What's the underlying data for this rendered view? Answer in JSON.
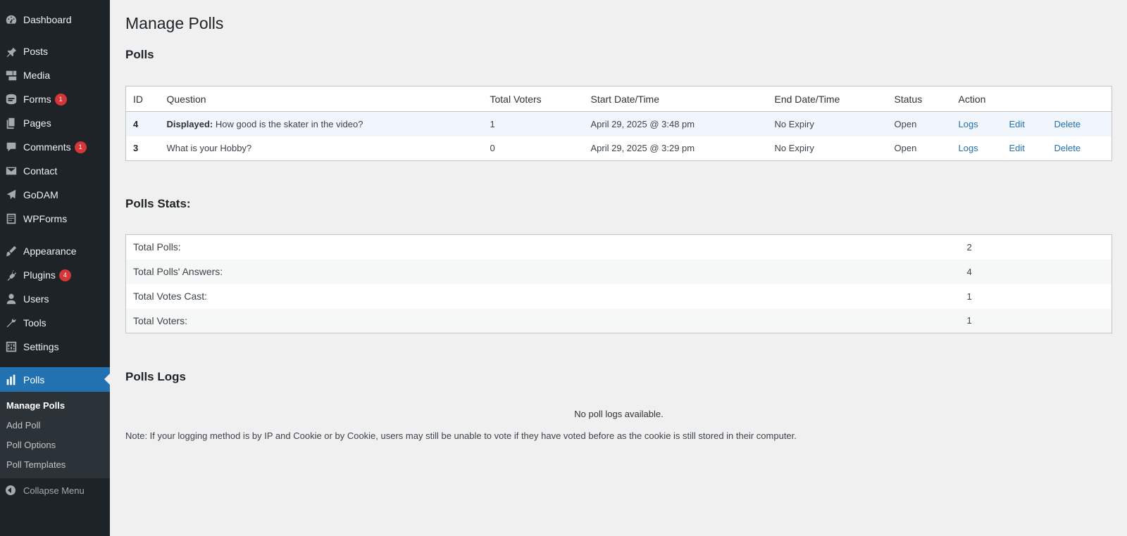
{
  "sidebar": {
    "items": [
      {
        "label": "Dashboard",
        "icon": "dashboard-icon"
      },
      {
        "label": "Posts",
        "icon": "pin-icon"
      },
      {
        "label": "Media",
        "icon": "media-icon"
      },
      {
        "label": "Forms",
        "icon": "forms-icon",
        "badge": "1"
      },
      {
        "label": "Pages",
        "icon": "pages-icon"
      },
      {
        "label": "Comments",
        "icon": "comment-icon",
        "badge": "1"
      },
      {
        "label": "Contact",
        "icon": "envelope-icon"
      },
      {
        "label": "GoDAM",
        "icon": "godam-icon"
      },
      {
        "label": "WPForms",
        "icon": "wpforms-icon"
      },
      {
        "label": "Appearance",
        "icon": "brush-icon"
      },
      {
        "label": "Plugins",
        "icon": "plugin-icon",
        "badge": "4"
      },
      {
        "label": "Users",
        "icon": "user-icon"
      },
      {
        "label": "Tools",
        "icon": "wrench-icon"
      },
      {
        "label": "Settings",
        "icon": "settings-icon"
      },
      {
        "label": "Polls",
        "icon": "bar-chart-icon"
      }
    ],
    "submenu": [
      "Manage Polls",
      "Add Poll",
      "Poll Options",
      "Poll Templates"
    ],
    "collapse_label": "Collapse Menu"
  },
  "page": {
    "title": "Manage Polls",
    "polls_heading": "Polls",
    "stats_heading": "Polls Stats:",
    "logs_heading": "Polls Logs"
  },
  "polls_table": {
    "headers": [
      "ID",
      "Question",
      "Total Voters",
      "Start Date/Time",
      "End Date/Time",
      "Status",
      "Action"
    ],
    "rows": [
      {
        "id": "4",
        "question_prefix": "Displayed:",
        "question": "How good is the skater in the video?",
        "voters": "1",
        "start": "April 29, 2025 @ 3:48 pm",
        "end": "No Expiry",
        "status": "Open",
        "logs": "Logs",
        "edit": "Edit",
        "delete": "Delete"
      },
      {
        "id": "3",
        "question_prefix": "",
        "question": "What is your Hobby?",
        "voters": "0",
        "start": "April 29, 2025 @ 3:29 pm",
        "end": "No Expiry",
        "status": "Open",
        "logs": "Logs",
        "edit": "Edit",
        "delete": "Delete"
      }
    ]
  },
  "stats": [
    {
      "label": "Total Polls:",
      "value": "2"
    },
    {
      "label": "Total Polls' Answers:",
      "value": "4"
    },
    {
      "label": "Total Votes Cast:",
      "value": "1"
    },
    {
      "label": "Total Voters:",
      "value": "1"
    }
  ],
  "logs": {
    "empty_text": "No poll logs available.",
    "note": "Note: If your logging method is by IP and Cookie or by Cookie, users may still be unable to vote if they have voted before as the cookie is still stored in their computer."
  },
  "colors": {
    "sidebar_bg": "#1d2327",
    "accent": "#2271b1",
    "badge": "#d63638",
    "page_bg": "#f0f0f1"
  }
}
